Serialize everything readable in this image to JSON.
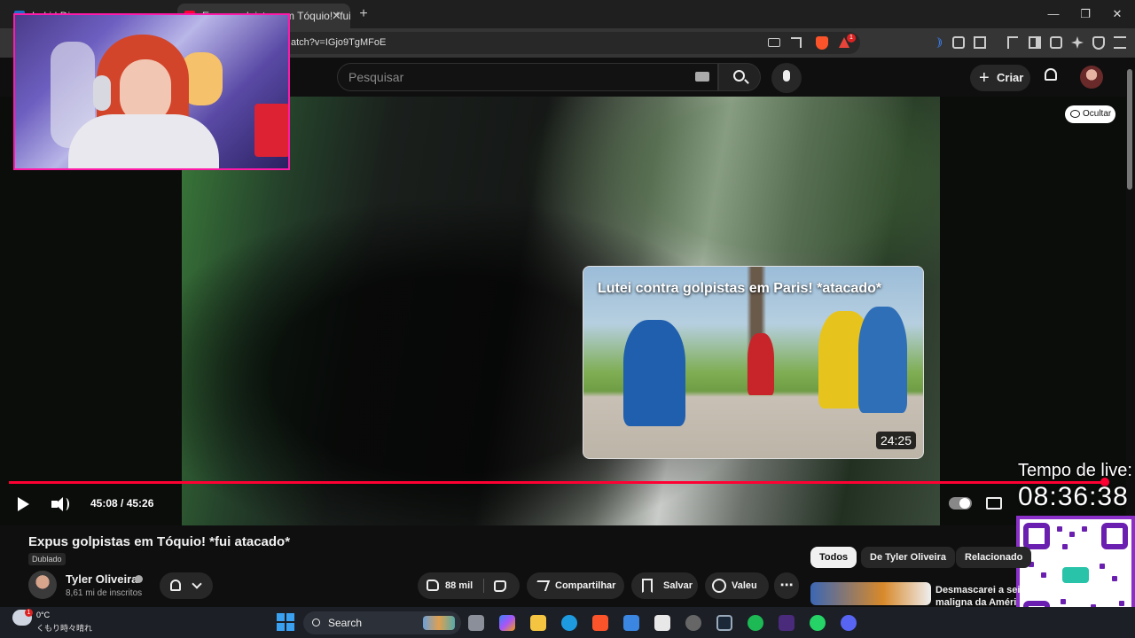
{
  "browser": {
    "tabs": [
      {
        "label": "Loki | Disney"
      },
      {
        "label": "Expus golpistas em Tóquio! *fui a",
        "close": "✕"
      }
    ],
    "new_tab": "+",
    "window_controls": [
      "—",
      "❐",
      "✕"
    ],
    "url": "atch?v=IGjo9TgMFoE",
    "shield_badge": "1"
  },
  "youtube": {
    "search_placeholder": "Pesquisar",
    "create_label": "Criar",
    "create_plus": "+"
  },
  "video": {
    "hide_label": "Ocultar",
    "endcard": {
      "title": "Lutei contra golpistas em Paris! *atacado*",
      "duration": "24:25"
    },
    "time_text": "45:08 / 45:26",
    "progress_fraction": 0.993
  },
  "live_overlay": {
    "label": "Tempo de live:",
    "time": "08:36:38"
  },
  "details": {
    "title": "Expus golpistas em Tóquio! *fui atacado*",
    "dubbed": "Dublado",
    "channel_name": "Tyler Oliveira",
    "subscribers": "8,61 mi de inscritos",
    "likes": "88 mil",
    "share": "Compartilhar",
    "save": "Salvar",
    "thanks": "Valeu",
    "more": "⋯"
  },
  "chips": [
    "Todos",
    "De Tyler Oliveira",
    "Relacionado"
  ],
  "related": {
    "title_line1": "Desmascarei a sei",
    "title_line2": "maligna da Améri"
  },
  "taskbar": {
    "temperature": "0°C",
    "weather_desc": "くもり時々晴れ",
    "weather_badge": "1",
    "search_label": "Search"
  },
  "colors": {
    "accent": "#ff0033",
    "webcam_border": "#ff1aa8",
    "qr_border": "#8b2fc9"
  }
}
